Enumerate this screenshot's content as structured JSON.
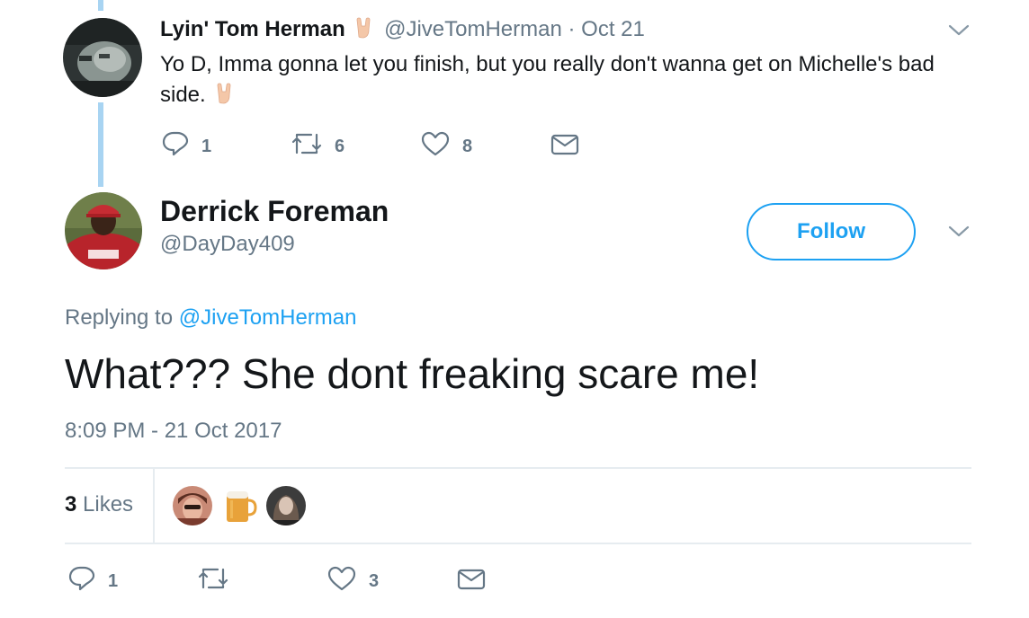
{
  "parent_tweet": {
    "name": "Lyin' Tom Herman",
    "handle": "@JiveTomHerman",
    "separator": "·",
    "date": "Oct 21",
    "text": "Yo D, Imma gonna let you finish, but you really don't wanna get on Michelle's bad side.",
    "emoji": "horns-hand-emoji",
    "actions": {
      "replies": "1",
      "retweets": "6",
      "likes": "8"
    }
  },
  "main_tweet": {
    "name": "Derrick Foreman",
    "handle": "@DayDay409",
    "follow_label": "Follow",
    "replying_prefix": "Replying to",
    "replying_handle": "@JiveTomHerman",
    "text": "What??? She dont freaking scare me!",
    "timestamp": "8:09 PM - 21 Oct 2017",
    "likes_count": "3",
    "likes_label": "Likes",
    "actions": {
      "replies": "1",
      "likes": "3"
    }
  },
  "colors": {
    "accent": "#1da1f2",
    "muted_text": "#657786",
    "primary_text": "#14171a",
    "thread_line": "#a8d4f2",
    "divider": "#e6ecf0"
  },
  "icons": [
    "reply-icon",
    "retweet-icon",
    "heart-icon",
    "mail-icon",
    "chevron-down-icon"
  ]
}
